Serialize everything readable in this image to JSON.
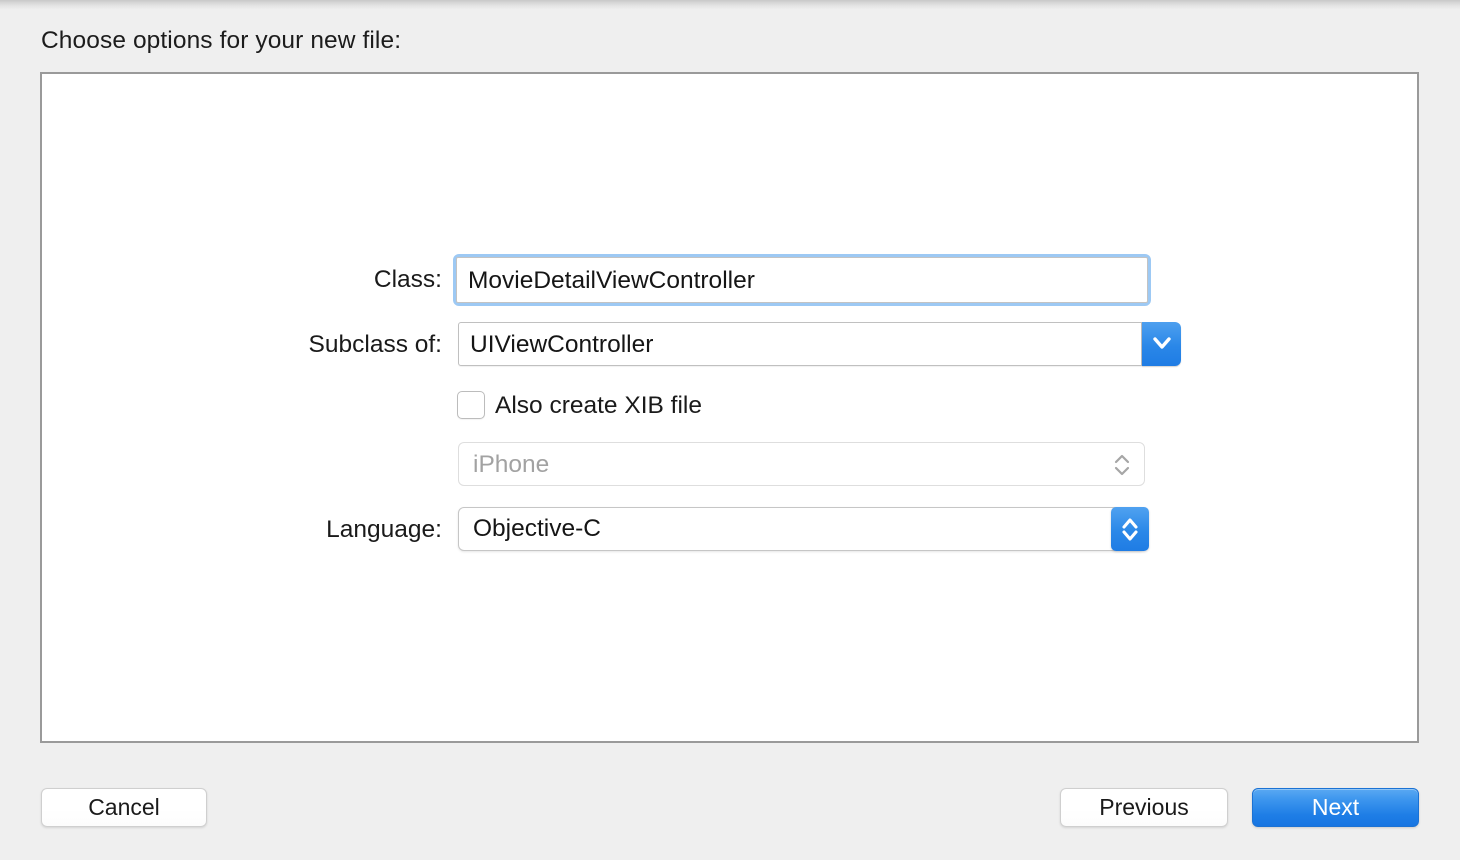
{
  "dialog": {
    "prompt": "Choose options for your new file:"
  },
  "form": {
    "class_row": {
      "label": "Class:",
      "value": "MovieDetailViewController",
      "placeholder": ""
    },
    "subclass_row": {
      "label": "Subclass of:",
      "value": "UIViewController",
      "arrow_icon": "chevron-down-icon"
    },
    "xib_row": {
      "label": "Also create XIB file",
      "checked": false
    },
    "device_row": {
      "label": "",
      "value": "iPhone",
      "enabled": false,
      "arrow_icon": "chevron-up-down-icon"
    },
    "language_row": {
      "label": "Language:",
      "value": "Objective-C",
      "arrow_icon": "chevron-up-down-icon"
    }
  },
  "footer": {
    "cancel_label": "Cancel",
    "previous_label": "Previous",
    "next_label": "Next"
  },
  "colors": {
    "accent_blue": "#1f7ce4",
    "focus_ring": "#9dc9f4",
    "window_background": "#efefef",
    "panel_background": "#ffffff",
    "panel_border": "#9a9a9a",
    "disabled_text": "#a2a2a2"
  }
}
